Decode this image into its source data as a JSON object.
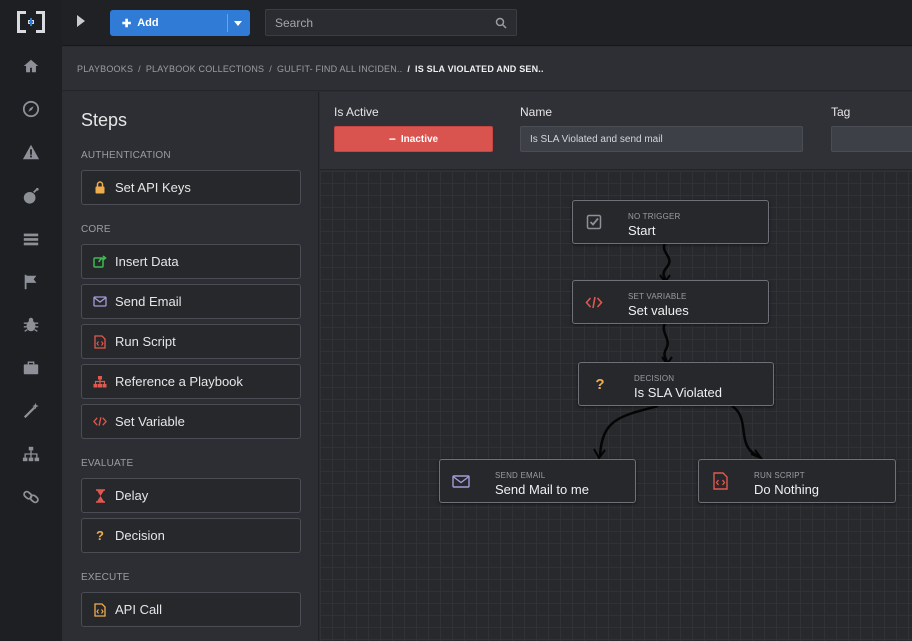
{
  "topbar": {
    "add_label": "Add",
    "search_placeholder": "Search"
  },
  "breadcrumb": {
    "items": [
      "PLAYBOOKS",
      "PLAYBOOK COLLECTIONS",
      "GULFIT- FIND ALL INCIDEN.."
    ],
    "current": "IS SLA VIOLATED AND SEN.."
  },
  "sidebar_icons": [
    "home-icon",
    "compass-icon",
    "alert-icon",
    "bomb-icon",
    "list-icon",
    "flag-icon",
    "bug-icon",
    "briefcase-icon",
    "wand-icon",
    "sitemap-icon",
    "link-icon"
  ],
  "steps": {
    "title": "Steps",
    "sections": [
      {
        "label": "AUTHENTICATION",
        "items": [
          {
            "label": "Set API Keys",
            "icon": "lock-icon"
          }
        ]
      },
      {
        "label": "CORE",
        "items": [
          {
            "label": "Insert Data",
            "icon": "share-icon"
          },
          {
            "label": "Send Email",
            "icon": "envelope-icon"
          },
          {
            "label": "Run Script",
            "icon": "script-file-icon"
          },
          {
            "label": "Reference a Playbook",
            "icon": "sitemap-icon"
          },
          {
            "label": "Set Variable",
            "icon": "code-icon"
          }
        ]
      },
      {
        "label": "EVALUATE",
        "items": [
          {
            "label": "Delay",
            "icon": "hourglass-icon"
          },
          {
            "label": "Decision",
            "icon": "question-icon"
          }
        ]
      },
      {
        "label": "EXECUTE",
        "items": [
          {
            "label": "API Call",
            "icon": "api-file-icon"
          }
        ]
      }
    ]
  },
  "form": {
    "is_active_label": "Is Active",
    "is_active_value": "Inactive",
    "name_label": "Name",
    "name_value": "Is SLA Violated and send mail",
    "tag_label": "Tag",
    "tag_value": ""
  },
  "flow": {
    "nodes": [
      {
        "type": "NO TRIGGER",
        "name": "Start",
        "icon": "checkbox-icon"
      },
      {
        "type": "SET VARIABLE",
        "name": "Set values",
        "icon": "code-icon"
      },
      {
        "type": "DECISION",
        "name": "Is SLA Violated",
        "icon": "question-icon"
      },
      {
        "type": "SEND EMAIL",
        "name": "Send Mail to me",
        "icon": "envelope-icon"
      },
      {
        "type": "RUN SCRIPT",
        "name": "Do Nothing",
        "icon": "script-file-icon"
      }
    ]
  },
  "colors": {
    "accent_blue": "#2f7bd5",
    "inactive_red": "#d9534f",
    "icon_orange": "#f0ad4e",
    "icon_red": "#e0584e",
    "icon_green": "#3fb950",
    "icon_purple": "#a59bd8"
  }
}
